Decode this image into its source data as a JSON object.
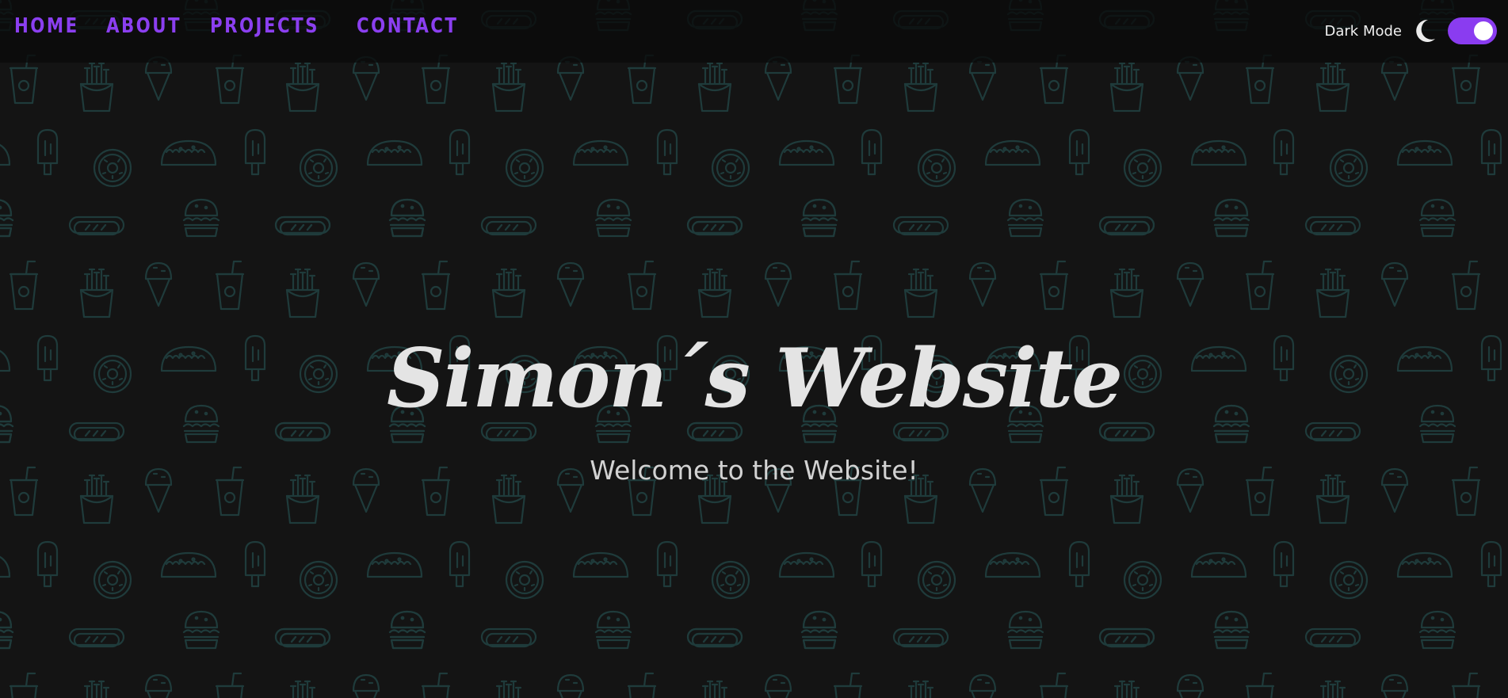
{
  "nav": {
    "links": [
      {
        "label": "HOME"
      },
      {
        "label": "ABOUT"
      },
      {
        "label": "PROJECTS"
      },
      {
        "label": "CONTACT"
      }
    ],
    "dark_mode_label": "Dark Mode",
    "dark_mode_enabled": true,
    "moon_icon": "moon-icon"
  },
  "hero": {
    "title": "Simon´s Website",
    "subtitle": "Welcome to the Website!"
  },
  "colors": {
    "background": "#141414",
    "accent": "#8b3ff0",
    "pattern_stroke": "#1f3b3b",
    "title": "#e4e4e4"
  },
  "background_pattern_icons": [
    "drink-cup-icon",
    "fries-icon",
    "ice-cream-cone-icon",
    "popsicle-icon",
    "donut-icon",
    "taco-icon",
    "hotdog-icon",
    "burger-icon"
  ]
}
